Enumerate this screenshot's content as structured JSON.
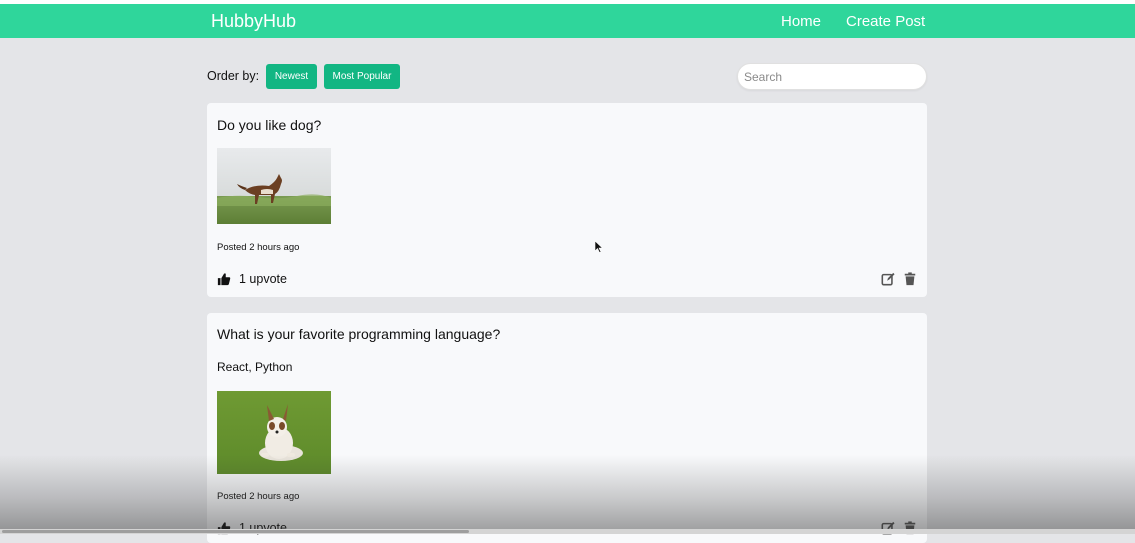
{
  "header": {
    "brand": "HubbyHub",
    "nav": {
      "home": "Home",
      "create_post": "Create Post"
    }
  },
  "toolbar": {
    "order_label": "Order by:",
    "newest_label": "Newest",
    "popular_label": "Most Popular",
    "search_placeholder": "Search"
  },
  "posts": [
    {
      "title": "Do you like dog?",
      "body": "",
      "image": "husky-dog-photo",
      "posted": "Posted 2 hours ago",
      "upvotes": "1 upvote"
    },
    {
      "title": "What is your favorite programming language?",
      "body": "React, Python",
      "image": "chihuahua-dog-photo",
      "posted": "Posted 2 hours ago",
      "upvotes": "1 upvote"
    }
  ],
  "colors": {
    "navbar": "#2fd69b",
    "button": "#12b683",
    "background": "#e4e5e8",
    "card": "#f8f9fb"
  },
  "icons": [
    "thumbs-up-icon",
    "edit-icon",
    "trash-icon"
  ]
}
